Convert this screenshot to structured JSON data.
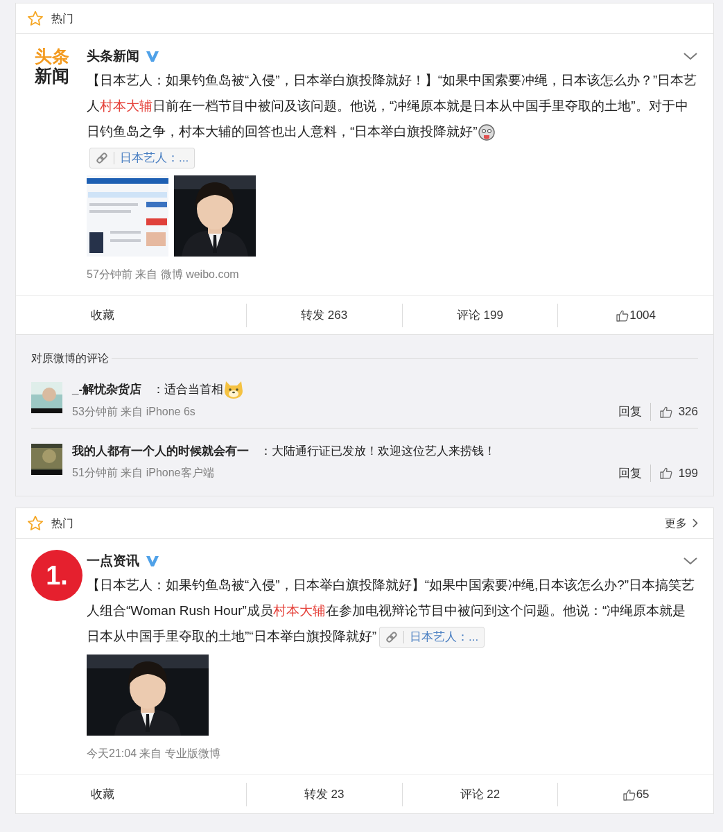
{
  "cards": [
    {
      "header": {
        "label": "热门"
      },
      "post": {
        "author": "头条新闻",
        "verified": true,
        "avatar": {
          "kind": "wordmark",
          "lines": [
            "头条",
            "新闻"
          ]
        },
        "body": [
          {
            "kind": "text",
            "text": "【日本艺人：如果钓鱼岛被“入侵”，日本举白旗投降就好！】“如果中国索要冲绳，日本该怎么办？”日本艺人"
          },
          {
            "kind": "mention",
            "text": "村本大辅"
          },
          {
            "kind": "text",
            "text": "日前在一档节目中被问及该问题。他说，“冲绳原本就是日本从中国手里夺取的土地”。对于中日钓鱼岛之争，村本大辅的回答也出人意料，“日本举白旗投降就好”"
          },
          {
            "kind": "emoji"
          },
          {
            "kind": "break"
          },
          {
            "kind": "link",
            "text": "日本艺人：..."
          }
        ],
        "meta": "57分钟前 来自 微博 weibo.com",
        "actions": [
          {
            "kind": "text",
            "label": "收藏"
          },
          {
            "kind": "text",
            "label": "转发 263"
          },
          {
            "kind": "text",
            "label": "评论 199"
          },
          {
            "kind": "like",
            "label": "1004"
          }
        ]
      },
      "comments": {
        "title": "对原微博的评论",
        "items": [
          {
            "user": "_-解忧杂货店",
            "separator": "：",
            "text": "适合当首相",
            "emoji": true,
            "time": "53分钟前 来自 iPhone 6s",
            "reply": "回复",
            "likes": "326"
          },
          {
            "user": "我的人都有一个人的时候就会有一",
            "separator": "：",
            "text": "大陆通行证已发放！欢迎这位艺人来捞钱！",
            "emoji": false,
            "time": "51分钟前 来自 iPhone客户端",
            "reply": "回复",
            "likes": "199"
          }
        ]
      }
    },
    {
      "header": {
        "label": "热门",
        "more": "更多"
      },
      "post": {
        "author": "一点资讯",
        "verified": true,
        "avatar": {
          "kind": "badge",
          "lines": [
            "1."
          ]
        },
        "body": [
          {
            "kind": "text",
            "text": "【日本艺人：如果钓鱼岛被“入侵”，日本举白旗投降就好】“如果中国索要冲绳,日本该怎么办?”日本搞笑艺人组合“Woman Rush Hour”成员"
          },
          {
            "kind": "mention",
            "text": "村本大辅"
          },
          {
            "kind": "text",
            "text": "在参加电视辩论节目中被问到这个问题。他说：“冲绳原本就是日本从中国手里夺取的土地”“日本举白旗投降就好”"
          },
          {
            "kind": "link",
            "text": "日本艺人：..."
          }
        ],
        "meta": "今天21:04 来自 专业版微博",
        "actions": [
          {
            "kind": "text",
            "label": "收藏"
          },
          {
            "kind": "text",
            "label": "转发 23"
          },
          {
            "kind": "text",
            "label": "评论 22"
          },
          {
            "kind": "like",
            "label": "65"
          }
        ]
      }
    }
  ]
}
